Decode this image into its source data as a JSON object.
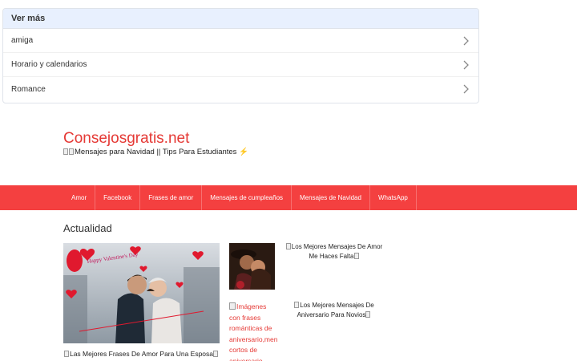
{
  "ver_mas": {
    "header": "Ver más",
    "items": [
      {
        "label": "amiga"
      },
      {
        "label": "Horario y calendarios"
      },
      {
        "label": "Romance"
      }
    ]
  },
  "site": {
    "title": "Consejosgratis.net",
    "tagline": "Mensajes para Navidad || Tips Para Estudiantes"
  },
  "nav": {
    "items": [
      {
        "label": "Amor"
      },
      {
        "label": "Facebook"
      },
      {
        "label": "Frases de amor"
      },
      {
        "label": "Mensajes de cumpleaños"
      },
      {
        "label": "Mensajes de Navidad"
      },
      {
        "label": "WhatsApp"
      }
    ]
  },
  "section": {
    "title": "Actualidad",
    "main_post": {
      "caption": "Las Mejores Frases De Amor Para Una Esposa",
      "image_text": "Happy Valentine's Day"
    },
    "side_posts": [
      {
        "title": "Los Mejores Mensajes De Amor Me Haces Falta"
      },
      {
        "title": "Los Mejores Mensajes De Aniversario Para Novios",
        "broken_image_alt": "Imágenes con frases románticas de aniversario,mensajes cortos de aniversario"
      }
    ]
  },
  "colors": {
    "accent": "#f44040",
    "title_red": "#e53935",
    "card_header_bg": "#e8f0fe"
  }
}
